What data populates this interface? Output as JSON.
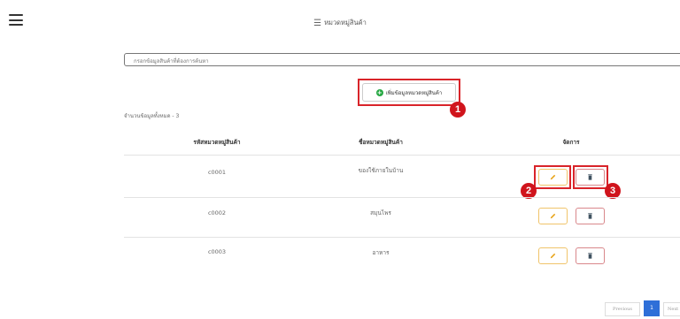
{
  "header": {
    "title": "หมวดหมู่สินค้า",
    "menu_icon": "hamburger-menu-icon"
  },
  "search": {
    "placeholder": "กรอกข้อมูลสินค้าที่ต้องการค้นหา"
  },
  "add_button": {
    "label": "เพิ่มข้อมูลหมวดหมู่สินค้า"
  },
  "total": {
    "label": "จำนวนข้อมูลทั้งหมด - 3"
  },
  "table": {
    "headers": [
      "รหัสหมวดหมู่สินค้า",
      "ชื่อหมวดหมู่สินค้า",
      "จัดการ"
    ],
    "rows": [
      {
        "code": "c0001",
        "name": "ของใช้ภายในบ้าน"
      },
      {
        "code": "c0002",
        "name": "สมุนไพร"
      },
      {
        "code": "c0003",
        "name": "อาหาร"
      }
    ]
  },
  "callouts": [
    "1",
    "2",
    "3"
  ],
  "pagination": {
    "previous": "Previous",
    "current": "1",
    "next": "Next"
  },
  "colors": {
    "callout": "#d0141c",
    "edit_border": "#f0c46a",
    "delete_border": "#d9878b",
    "pager_active": "#2e6fd8",
    "add_icon": "#27a843"
  }
}
